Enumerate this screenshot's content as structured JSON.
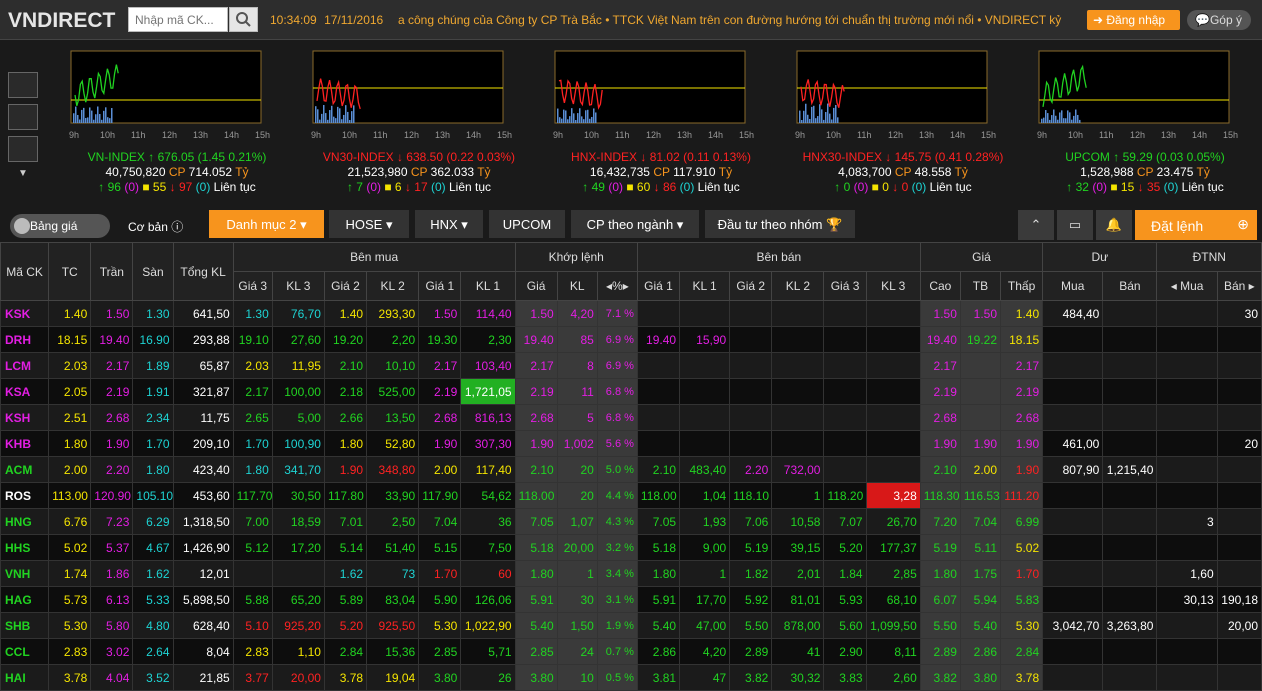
{
  "header": {
    "logo": "VNDIRECT",
    "search_placeholder": "Nhập mã CK...",
    "time": "10:34:09",
    "date": "17/11/2016",
    "ticker_text": "a công chúng của Công ty CP Trà Bắc  •  TTCK Việt Nam trên con đường hướng tới chuẩn thị trường mới nổi  •  VNDIRECT kỷ",
    "login_label": "Đăng nhập",
    "feedback_label": "Góp ý"
  },
  "hours": [
    "9h",
    "10h",
    "11h",
    "12h",
    "13h",
    "14h",
    "15h"
  ],
  "indices": [
    {
      "name": "VN-INDEX",
      "value": "676.05",
      "change": "(1.45 0.21%)",
      "dir": "up",
      "volume": "40,750,820",
      "cp_value": "714.052",
      "unit": "Tỷ",
      "adv": "96",
      "ceil_adv": "(0)",
      "ref": "55",
      "dec": "97",
      "floor_dec": "(0)",
      "status": "Liên tục",
      "vol_level": 0.45
    },
    {
      "name": "VN30-INDEX",
      "value": "638.50",
      "change": "(0.22 0.03%)",
      "dir": "dn",
      "volume": "21,523,980",
      "cp_value": "362.033",
      "unit": "Tỷ",
      "adv": "7",
      "ceil_adv": "(0)",
      "ref": "6",
      "dec": "17",
      "floor_dec": "(0)",
      "status": "Liên tục",
      "vol_level": 0.5
    },
    {
      "name": "HNX-INDEX",
      "value": "81.02",
      "change": "(0.11 0.13%)",
      "dir": "dn",
      "volume": "16,432,735",
      "cp_value": "117.910",
      "unit": "Tỷ",
      "adv": "49",
      "ceil_adv": "(0)",
      "ref": "60",
      "dec": "86",
      "floor_dec": "(0)",
      "status": "Liên tục",
      "vol_level": 0.4
    },
    {
      "name": "HNX30-INDEX",
      "value": "145.75",
      "change": "(0.41 0.28%)",
      "dir": "dn",
      "volume": "4,083,700",
      "cp_value": "48.558",
      "unit": "Tỷ",
      "adv": "0",
      "ceil_adv": "(0)",
      "ref": "0",
      "dec": "0",
      "floor_dec": "(0)",
      "status": "Liên tục",
      "vol_level": 0.55
    },
    {
      "name": "UPCOM",
      "value": "59.29",
      "change": "(0.03 0.05%)",
      "dir": "up",
      "volume": "1,528,988",
      "cp_value": "23.475",
      "unit": "Tỷ",
      "adv": "32",
      "ceil_adv": "(0)",
      "ref": "15",
      "dec": "35",
      "floor_dec": "(0)",
      "status": "Liên tục",
      "vol_level": 0.35
    }
  ],
  "tabs": {
    "bang_gia": "Bảng giá",
    "co_ban": "Cơ bản",
    "danh_muc": "Danh mục 2",
    "hose": "HOSE",
    "hnx": "HNX",
    "upcom": "UPCOM",
    "cp_theo_nganh": "CP theo ngành",
    "dau_tu": "Đầu tư theo nhóm",
    "dat_lenh": "Đặt lệnh"
  },
  "table_headers": {
    "ma_ck": "Mã CK",
    "tc": "TC",
    "tran": "Trần",
    "san": "Sàn",
    "tong_kl": "Tổng KL",
    "ben_mua": "Bên mua",
    "khop_lenh": "Khớp lệnh",
    "ben_ban": "Bên bán",
    "gia": "Giá",
    "du": "Dư",
    "dtnn": "ĐTNN",
    "gia3": "Giá 3",
    "kl3": "KL 3",
    "gia2": "Giá 2",
    "kl2": "KL 2",
    "gia1": "Giá 1",
    "kl1": "KL 1",
    "k_gia": "Giá",
    "k_kl": "KL",
    "k_pct": "%",
    "s_gia1": "Giá 1",
    "s_kl1": "KL 1",
    "s_gia2": "Giá 2",
    "s_kl2": "KL 2",
    "s_gia3": "Giá 3",
    "s_kl3": "KL 3",
    "cao": "Cao",
    "tb": "TB",
    "thap": "Thấp",
    "du_mua": "Mua",
    "du_ban": "Bán",
    "nn_mua": "Mua",
    "nn_ban": "Bán"
  },
  "rows": [
    [
      "KSK",
      "1.40",
      "1.50",
      "1.30",
      "641,50",
      "1.30",
      "76,70",
      "1.40",
      "293,30",
      "1.50",
      "114,40",
      "1.50",
      "4,20",
      "7.1",
      "",
      "",
      "",
      "",
      "",
      "",
      "1.50",
      "1.50",
      "1.40",
      "484,40",
      "",
      "",
      "30"
    ],
    [
      "DRH",
      "18.15",
      "19.40",
      "16.90",
      "293,88",
      "19.10",
      "27,60",
      "19.20",
      "2,20",
      "19.30",
      "2,30",
      "19.40",
      "85",
      "6.9",
      "19.40",
      "15,90",
      "",
      "",
      "",
      "",
      "19.40",
      "19.22",
      "18.15",
      "",
      "",
      "",
      ""
    ],
    [
      "LCM",
      "2.03",
      "2.17",
      "1.89",
      "65,87",
      "2.03",
      "11,95",
      "2.10",
      "10,10",
      "2.17",
      "103,40",
      "2.17",
      "8",
      "6.9",
      "",
      "",
      "",
      "",
      "",
      "",
      "2.17",
      "",
      "2.17",
      "",
      "",
      "",
      ""
    ],
    [
      "KSA",
      "2.05",
      "2.19",
      "1.91",
      "321,87",
      "2.17",
      "100,00",
      "2.18",
      "525,00",
      "2.19",
      "1,721,05",
      "2.19",
      "11",
      "6.8",
      "",
      "",
      "",
      "",
      "",
      "",
      "2.19",
      "",
      "2.19",
      "",
      "",
      "",
      ""
    ],
    [
      "KSH",
      "2.51",
      "2.68",
      "2.34",
      "11,75",
      "2.65",
      "5,00",
      "2.66",
      "13,50",
      "2.68",
      "816,13",
      "2.68",
      "5",
      "6.8",
      "",
      "",
      "",
      "",
      "",
      "",
      "2.68",
      "",
      "2.68",
      "",
      "",
      "",
      ""
    ],
    [
      "KHB",
      "1.80",
      "1.90",
      "1.70",
      "209,10",
      "1.70",
      "100,90",
      "1.80",
      "52,80",
      "1.90",
      "307,30",
      "1.90",
      "1,002",
      "5.6",
      "",
      "",
      "",
      "",
      "",
      "",
      "1.90",
      "1.90",
      "1.90",
      "461,00",
      "",
      "",
      "20"
    ],
    [
      "ACM",
      "2.00",
      "2.20",
      "1.80",
      "423,40",
      "1.80",
      "341,70",
      "1.90",
      "348,80",
      "2.00",
      "117,40",
      "2.10",
      "20",
      "5.0",
      "2.10",
      "483,40",
      "2.20",
      "732,00",
      "",
      "",
      "2.10",
      "2.00",
      "1.90",
      "807,90",
      "1,215,40",
      "",
      ""
    ],
    [
      "ROS",
      "113.00",
      "120.90",
      "105.10",
      "453,60",
      "117.70",
      "30,50",
      "117.80",
      "33,90",
      "117.90",
      "54,62",
      "118.00",
      "20",
      "4.4",
      "118.00",
      "1,04",
      "118.10",
      "1",
      "118.20",
      "3,28",
      "118.30",
      "116.53",
      "111.20",
      "",
      "",
      "",
      ""
    ],
    [
      "HNG",
      "6.76",
      "7.23",
      "6.29",
      "1,318,50",
      "7.00",
      "18,59",
      "7.01",
      "2,50",
      "7.04",
      "36",
      "7.05",
      "1,07",
      "4.3",
      "7.05",
      "1,93",
      "7.06",
      "10,58",
      "7.07",
      "26,70",
      "7.20",
      "7.04",
      "6.99",
      "",
      "",
      "3",
      ""
    ],
    [
      "HHS",
      "5.02",
      "5.37",
      "4.67",
      "1,426,90",
      "5.12",
      "17,20",
      "5.14",
      "51,40",
      "5.15",
      "7,50",
      "5.18",
      "20,00",
      "3.2",
      "5.18",
      "9,00",
      "5.19",
      "39,15",
      "5.20",
      "177,37",
      "5.19",
      "5.11",
      "5.02",
      "",
      "",
      "",
      ""
    ],
    [
      "VNH",
      "1.74",
      "1.86",
      "1.62",
      "12,01",
      "",
      "",
      "1.62",
      "73",
      "1.70",
      "60",
      "1.80",
      "1",
      "3.4",
      "1.80",
      "1",
      "1.82",
      "2,01",
      "1.84",
      "2,85",
      "1.80",
      "1.75",
      "1.70",
      "",
      "",
      "1,60",
      ""
    ],
    [
      "HAG",
      "5.73",
      "6.13",
      "5.33",
      "5,898,50",
      "5.88",
      "65,20",
      "5.89",
      "83,04",
      "5.90",
      "126,06",
      "5.91",
      "30",
      "3.1",
      "5.91",
      "17,70",
      "5.92",
      "81,01",
      "5.93",
      "68,10",
      "6.07",
      "5.94",
      "5.83",
      "",
      "",
      "30,13",
      "190,18"
    ],
    [
      "SHB",
      "5.30",
      "5.80",
      "4.80",
      "628,40",
      "5.10",
      "925,20",
      "5.20",
      "925,50",
      "5.30",
      "1,022,90",
      "5.40",
      "1,50",
      "1.9",
      "5.40",
      "47,00",
      "5.50",
      "878,00",
      "5.60",
      "1,099,50",
      "5.50",
      "5.40",
      "5.30",
      "3,042,70",
      "3,263,80",
      "",
      "20,00"
    ],
    [
      "CCL",
      "2.83",
      "3.02",
      "2.64",
      "8,04",
      "2.83",
      "1,10",
      "2.84",
      "15,36",
      "2.85",
      "5,71",
      "2.85",
      "24",
      "0.7",
      "2.86",
      "4,20",
      "2.89",
      "41",
      "2.90",
      "8,11",
      "2.89",
      "2.86",
      "2.84",
      "",
      "",
      "",
      ""
    ],
    [
      "HAI",
      "3.78",
      "4.04",
      "3.52",
      "21,85",
      "3.77",
      "20,00",
      "3.78",
      "19,04",
      "3.80",
      "26",
      "3.80",
      "10",
      "0.5",
      "3.81",
      "47",
      "3.82",
      "30,32",
      "3.83",
      "2,60",
      "3.82",
      "3.80",
      "3.78",
      "",
      "",
      "",
      ""
    ]
  ],
  "row_colors": [
    [
      "ce",
      "ref",
      "ce",
      "fl",
      "wh",
      "fl",
      "fl",
      "ref",
      "ref",
      "ce",
      "ce",
      "ce",
      "ce",
      "ce",
      "wh",
      "wh",
      "wh",
      "wh",
      "wh",
      "wh",
      "ce",
      "ce",
      "ref",
      "wh",
      "wh",
      "wh",
      "wh"
    ],
    [
      "ce",
      "ref",
      "ce",
      "fl",
      "wh",
      "up",
      "up",
      "up",
      "up",
      "up",
      "up",
      "ce",
      "ce",
      "ce",
      "ce",
      "ce",
      "wh",
      "wh",
      "wh",
      "wh",
      "ce",
      "up",
      "ref",
      "wh",
      "wh",
      "wh",
      "wh"
    ],
    [
      "ce",
      "ref",
      "ce",
      "fl",
      "wh",
      "ref",
      "ref",
      "up",
      "up",
      "ce",
      "ce",
      "ce",
      "ce",
      "ce",
      "wh",
      "wh",
      "wh",
      "wh",
      "wh",
      "wh",
      "ce",
      "wh",
      "ce",
      "wh",
      "wh",
      "wh",
      "wh"
    ],
    [
      "ce",
      "ref",
      "ce",
      "fl",
      "wh",
      "up",
      "up",
      "up",
      "up",
      "ce",
      "wh",
      "ce",
      "ce",
      "ce",
      "wh",
      "wh",
      "wh",
      "wh",
      "wh",
      "wh",
      "ce",
      "wh",
      "ce",
      "wh",
      "wh",
      "wh",
      "wh"
    ],
    [
      "ce",
      "ref",
      "ce",
      "fl",
      "wh",
      "up",
      "up",
      "up",
      "up",
      "ce",
      "ce",
      "ce",
      "ce",
      "ce",
      "wh",
      "wh",
      "wh",
      "wh",
      "wh",
      "wh",
      "ce",
      "wh",
      "ce",
      "wh",
      "wh",
      "wh",
      "wh"
    ],
    [
      "ce",
      "ref",
      "ce",
      "fl",
      "wh",
      "fl",
      "fl",
      "ref",
      "ref",
      "ce",
      "ce",
      "ce",
      "ce",
      "ce",
      "wh",
      "wh",
      "wh",
      "wh",
      "wh",
      "wh",
      "ce",
      "ce",
      "ce",
      "wh",
      "wh",
      "wh",
      "wh"
    ],
    [
      "up",
      "ref",
      "ce",
      "fl",
      "wh",
      "fl",
      "fl",
      "dn",
      "dn",
      "ref",
      "ref",
      "up",
      "up",
      "up",
      "up",
      "up",
      "ce",
      "ce",
      "wh",
      "wh",
      "up",
      "ref",
      "dn",
      "wh",
      "wh",
      "wh",
      "wh"
    ],
    [
      "wh",
      "ref",
      "ce",
      "fl",
      "wh",
      "up",
      "up",
      "up",
      "up",
      "up",
      "up",
      "up",
      "up",
      "up",
      "up",
      "up",
      "up",
      "up",
      "up",
      "wh",
      "up",
      "up",
      "dn",
      "wh",
      "wh",
      "wh",
      "wh"
    ],
    [
      "up",
      "ref",
      "ce",
      "fl",
      "wh",
      "up",
      "up",
      "up",
      "up",
      "up",
      "up",
      "up",
      "up",
      "up",
      "up",
      "up",
      "up",
      "up",
      "up",
      "up",
      "up",
      "up",
      "up",
      "wh",
      "wh",
      "wh",
      "wh"
    ],
    [
      "up",
      "ref",
      "ce",
      "fl",
      "wh",
      "up",
      "up",
      "up",
      "up",
      "up",
      "up",
      "up",
      "up",
      "up",
      "up",
      "up",
      "up",
      "up",
      "up",
      "up",
      "up",
      "up",
      "ref",
      "wh",
      "wh",
      "wh",
      "wh"
    ],
    [
      "up",
      "ref",
      "ce",
      "fl",
      "wh",
      "wh",
      "wh",
      "fl",
      "fl",
      "dn",
      "dn",
      "up",
      "up",
      "up",
      "up",
      "up",
      "up",
      "up",
      "up",
      "up",
      "up",
      "up",
      "dn",
      "wh",
      "wh",
      "wh",
      "wh"
    ],
    [
      "up",
      "ref",
      "ce",
      "fl",
      "wh",
      "up",
      "up",
      "up",
      "up",
      "up",
      "up",
      "up",
      "up",
      "up",
      "up",
      "up",
      "up",
      "up",
      "up",
      "up",
      "up",
      "up",
      "up",
      "wh",
      "wh",
      "wh",
      "wh"
    ],
    [
      "up",
      "ref",
      "ce",
      "fl",
      "wh",
      "dn",
      "dn",
      "dn",
      "dn",
      "ref",
      "ref",
      "up",
      "up",
      "up",
      "up",
      "up",
      "up",
      "up",
      "up",
      "up",
      "up",
      "up",
      "ref",
      "wh",
      "wh",
      "wh",
      "wh"
    ],
    [
      "up",
      "ref",
      "ce",
      "fl",
      "wh",
      "ref",
      "ref",
      "up",
      "up",
      "up",
      "up",
      "up",
      "up",
      "up",
      "up",
      "up",
      "up",
      "up",
      "up",
      "up",
      "up",
      "up",
      "up",
      "wh",
      "wh",
      "wh",
      "wh"
    ],
    [
      "up",
      "ref",
      "ce",
      "fl",
      "wh",
      "dn",
      "dn",
      "ref",
      "ref",
      "up",
      "up",
      "up",
      "up",
      "up",
      "up",
      "up",
      "up",
      "up",
      "up",
      "up",
      "up",
      "up",
      "ref",
      "wh",
      "wh",
      "wh",
      "wh"
    ]
  ]
}
